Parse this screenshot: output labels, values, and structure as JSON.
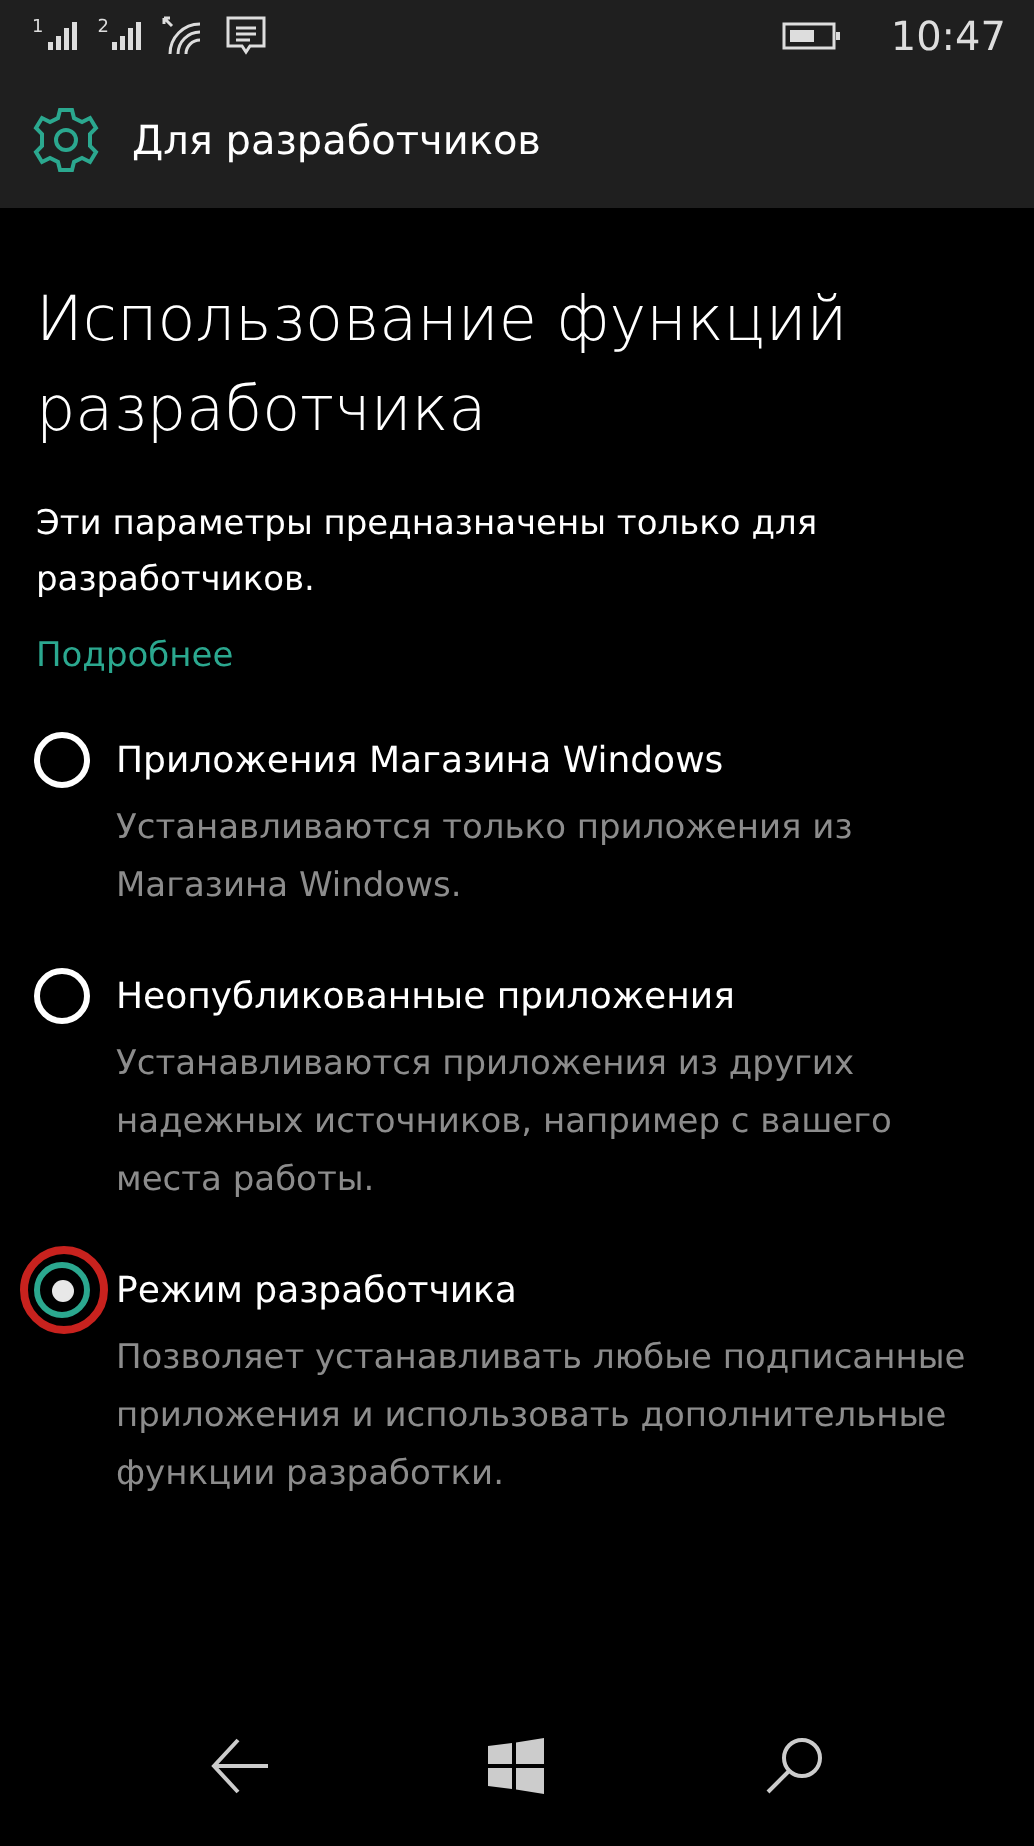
{
  "status_bar": {
    "sims": [
      "1",
      "2"
    ],
    "time": "10:47"
  },
  "header": {
    "title": "Для разработчиков"
  },
  "page": {
    "title": "Использование функций разработчика",
    "intro": "Эти параметры предназначены только для разработчиков.",
    "link": "Подробнее"
  },
  "options": [
    {
      "label": "Приложения Магазина Windows",
      "description": "Устанавливаются только приложения из Магазина Windows.",
      "selected": false,
      "highlighted": false
    },
    {
      "label": "Неопубликованные приложения",
      "description": "Устанавливаются приложения из других надежных источников, например с вашего места работы.",
      "selected": false,
      "highlighted": false
    },
    {
      "label": "Режим разработчика",
      "description": "Позволяет устанавливать любые подписанные приложения и использовать дополнительные функции разработки.",
      "selected": true,
      "highlighted": true
    }
  ]
}
